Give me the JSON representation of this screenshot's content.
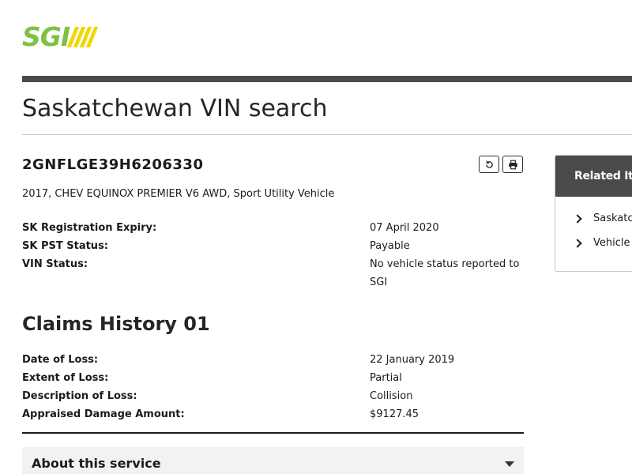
{
  "brand": {
    "logo_text": "SGI",
    "accent": "#7dc242",
    "stripe_color": "#f2d600"
  },
  "page": {
    "title": "Saskatchewan VIN search"
  },
  "vehicle": {
    "vin": "2GNFLGE39H6206330",
    "description": "2017, CHEV EQUINOX PREMIER V6 AWD, Sport Utility Vehicle",
    "actions": {
      "refresh_icon": "refresh-icon",
      "print_icon": "print-icon"
    }
  },
  "details": [
    {
      "label": "SK Registration Expiry:",
      "value": "07 April 2020"
    },
    {
      "label": "SK PST Status:",
      "value": "Payable"
    },
    {
      "label": "VIN Status:",
      "value": "No vehicle status reported to SGI"
    }
  ],
  "claims": {
    "title": "Claims History 01",
    "rows": [
      {
        "label": "Date of Loss:",
        "value": "22 January 2019"
      },
      {
        "label": "Extent of Loss:",
        "value": "Partial"
      },
      {
        "label": "Description of Loss:",
        "value": "Collision"
      },
      {
        "label": "Appraised Damage Amount:",
        "value": "$9127.45"
      }
    ]
  },
  "about": {
    "label": "About this service"
  },
  "related": {
    "heading": "Related Ite",
    "items": [
      {
        "label": "Saskatc"
      },
      {
        "label": "Vehicle"
      }
    ]
  }
}
